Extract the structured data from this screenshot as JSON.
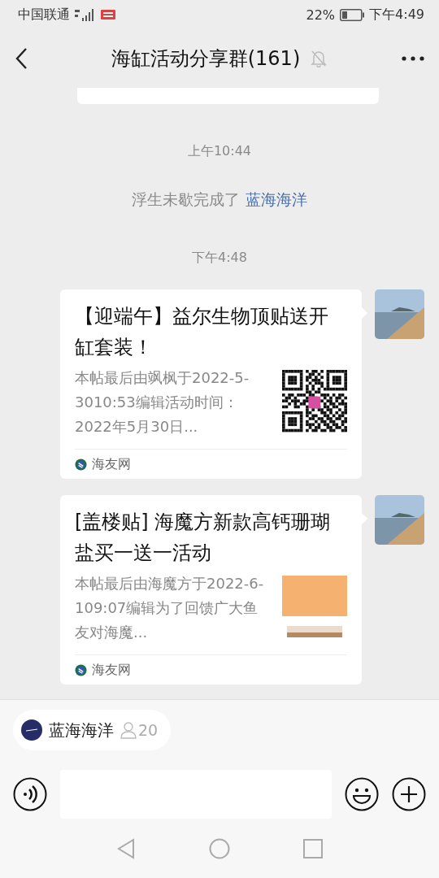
{
  "status_bar": {
    "carrier": "中国联通",
    "battery": "22%",
    "time": "下午4:49"
  },
  "header": {
    "title": "海缸活动分享群(161)",
    "muted": true
  },
  "messages": [
    {
      "kind": "partial"
    },
    {
      "kind": "time",
      "text": "上午10:44"
    },
    {
      "kind": "system",
      "text": "浮生未歇完成了",
      "link": "蓝海海洋"
    },
    {
      "kind": "time",
      "text": "下午4:48"
    },
    {
      "kind": "card",
      "title": "【迎端午】益尔生物顶贴送开缸套装！",
      "desc": "本帖最后由飒枫于2022-5-3010:53编辑活动时间：2022年5月30日...",
      "thumbnail": {
        "kind": "qr"
      },
      "source": "海友网"
    },
    {
      "kind": "card",
      "title": "[盖楼贴] 海魔方新款高钙珊瑚盐买一送一活动",
      "desc": "本帖最后由海魔方于2022-6-109:07编辑为了回馈广大鱼友对海魔...",
      "thumbnail": {
        "kind": "poster"
      },
      "source": "海友网"
    }
  ],
  "mention_chip": {
    "name": "蓝海海洋",
    "count": "20"
  }
}
